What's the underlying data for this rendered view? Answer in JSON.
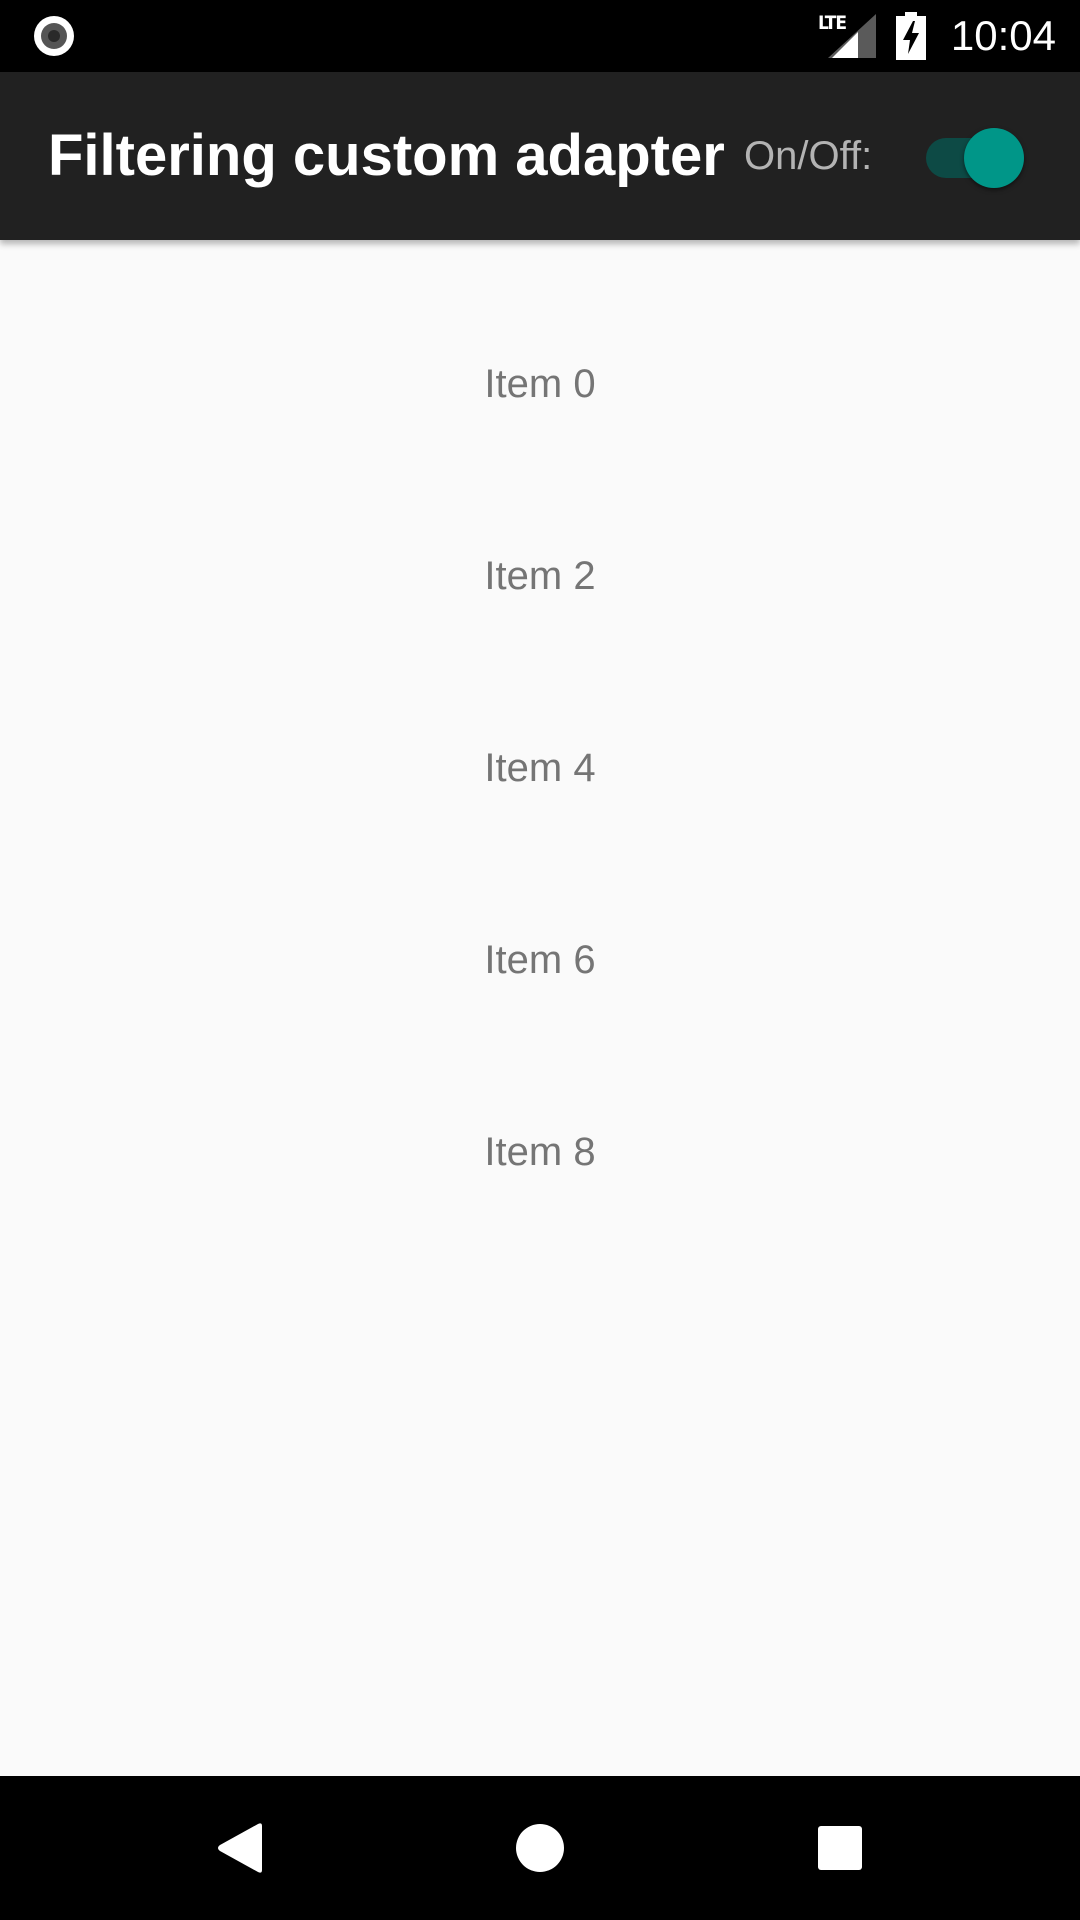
{
  "status_bar": {
    "time": "10:04",
    "network_label": "LTE",
    "left_icon": "record-indicator-icon",
    "signal_icon": "cell-signal-icon",
    "battery_icon": "battery-charging-icon"
  },
  "app_bar": {
    "title": "Filtering custom adapter",
    "switch_label": "On/Off:",
    "switch_on": true
  },
  "list": {
    "items": [
      {
        "label": "Item 0"
      },
      {
        "label": "Item 2"
      },
      {
        "label": "Item 4"
      },
      {
        "label": "Item 6"
      },
      {
        "label": "Item 8"
      }
    ]
  },
  "nav_bar": {
    "back_icon": "back-triangle-icon",
    "home_icon": "home-circle-icon",
    "recents_icon": "recents-square-icon"
  },
  "colors": {
    "status_bar_bg": "#000000",
    "app_bar_bg": "#212121",
    "background": "#fafafa",
    "accent": "#009688",
    "switch_track": "#0d4a45",
    "list_text": "#757575",
    "switch_label_text": "#b3b3b3"
  }
}
